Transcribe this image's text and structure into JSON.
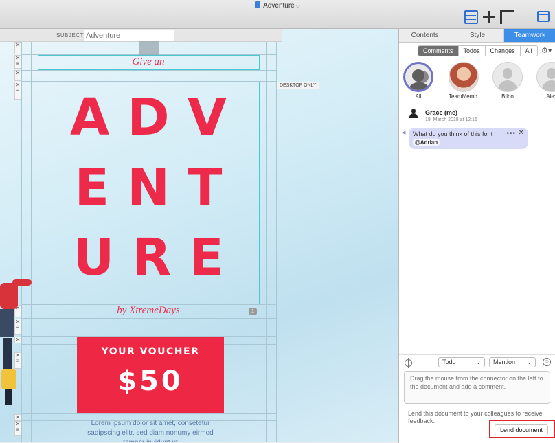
{
  "window": {
    "title": "Adventure"
  },
  "toolbar": {
    "icons": [
      "layout-icon",
      "move-icon",
      "ruler-icon",
      "window-icon"
    ],
    "accent": "#2f6fd1"
  },
  "canvas": {
    "subject_label": "SUBJECT",
    "subject_placeholder": "Adventure",
    "desktop_only_tag": "DESKTOP ONLY",
    "give_an": "Give an",
    "headline_lines": [
      "ADV",
      "ENT",
      "URE"
    ],
    "byline": "by XtremeDays",
    "comment_count": "1",
    "voucher_title": "YOUR VOUCHER",
    "voucher_amount": "$50",
    "lorem": "Lorem ipsum dolor sit amet, consetetur sadipscing elitr, sed diam nonumy eirmod tempor invidunt ut",
    "headline_color": "#ee2a4a",
    "voucher_color": "#ee2844"
  },
  "panel": {
    "tabs": [
      "Contents",
      "Style",
      "Teamwork"
    ],
    "active_tab": "Teamwork",
    "filters": [
      "Comments",
      "Todos",
      "Changes",
      "All"
    ],
    "active_filter": "Comments",
    "members": [
      "All",
      "TeamMemb...",
      "Bilbo",
      "Alex"
    ],
    "comment": {
      "author": "Grace (me)",
      "date": "19. March 2018 at 12:16",
      "text": "What do you think of this font",
      "mention": "@Adrian",
      "more": "•••",
      "close": "✕"
    },
    "todo_select": "Todo",
    "mention_select": "Mention",
    "comment_placeholder": "Drag the mouse from the connector on the left to the document and add a comment.",
    "lend_text": "Lend this document to your colleagues to receive feedback.",
    "lend_button": "Lend document",
    "highlight_color": "#e0252a",
    "active_tab_color": "#3d8ee6"
  }
}
